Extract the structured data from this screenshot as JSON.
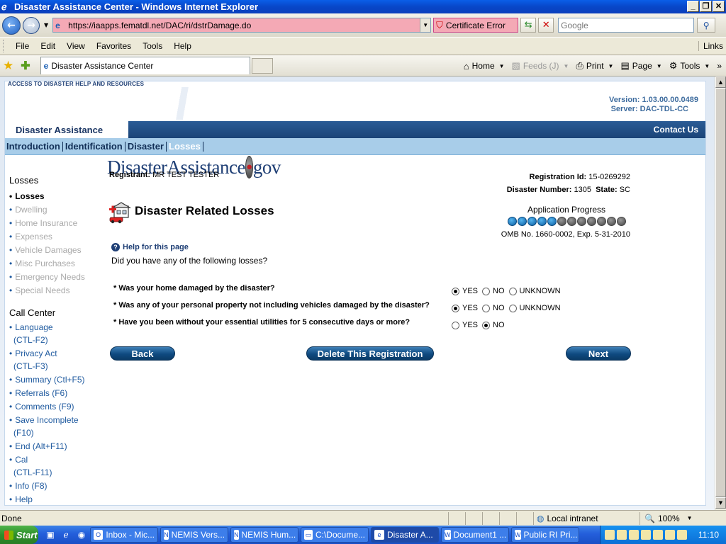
{
  "window": {
    "title": "Disaster Assistance Center - Windows Internet Explorer",
    "minimize": "_",
    "restore": "❐",
    "close": "✕"
  },
  "address": {
    "url": "https://iaapps.fematdl.net/DAC/ri/dstrDamage.do",
    "cert_error": "Certificate Error",
    "search_placeholder": "Google"
  },
  "menu": {
    "items": [
      "File",
      "Edit",
      "View",
      "Favorites",
      "Tools",
      "Help"
    ],
    "links": "Links"
  },
  "tabbar": {
    "tab_label": "Disaster Assistance Center",
    "home": "Home",
    "feeds": "Feeds (J)",
    "print": "Print",
    "page": "Page",
    "tools": "Tools"
  },
  "header": {
    "logo_main": "DisasterAssistance",
    "logo_dot": "•",
    "logo_gov": "gov",
    "logo_tag": "ACCESS TO DISASTER HELP AND RESOURCES",
    "version": "Version: 1.03.00.00.0489",
    "server": "Server: DAC-TDL-CC",
    "brand": "Disaster Assistance",
    "contact": "Contact Us"
  },
  "nav": {
    "tabs": [
      "Introduction",
      "Identification",
      "Disaster",
      "Losses"
    ],
    "active_index": 3
  },
  "sidebar": {
    "losses_head": "Losses",
    "losses_items": [
      "Losses",
      "Dwelling",
      "Home Insurance",
      "Expenses",
      "Vehicle Damages",
      "Misc Purchases",
      "Emergency Needs",
      "Special Needs"
    ],
    "call_head": "Call Center",
    "call_items": {
      "language": "Language",
      "language_key": "(CTL-F2)",
      "privacy": "Privacy Act",
      "privacy_key": "(CTL-F3)",
      "summary": "Summary (Ctl+F5)",
      "referrals": "Referrals (F6)",
      "comments": "Comments (F9)",
      "save": "Save Incomplete",
      "save_key": "(F10)",
      "end": "End (Alt+F11)",
      "cal": "Cal",
      "cal_key": "(CTL-F11)",
      "info": "Info (F8)",
      "help": "Help"
    }
  },
  "main": {
    "registrant_label": "Registrant:",
    "registrant_value": "MR TEST TESTER",
    "regid_label": "Registration Id:",
    "regid_value": "15-0269292",
    "disaster_label": "Disaster Number:",
    "disaster_value": "1305",
    "state_label": "State:",
    "state_value": "SC",
    "title": "Disaster Related Losses",
    "progress_label": "Application Progress",
    "progress_steps": 12,
    "progress_done": 5,
    "omb": "OMB No. 1660-0002, Exp. 5-31-2010",
    "help_link": "Help for this page",
    "question": "Did you have any of the following losses?",
    "q1": "* Was your home damaged by the disaster?",
    "q2": "* Was any of your personal property not including vehicles damaged by the disaster?",
    "q3": "* Have you been without your essential utilities for 5 consecutive days or more?",
    "opt_yes": "YES",
    "opt_no": "NO",
    "opt_unknown": "UNKNOWN",
    "back": "Back",
    "delete": "Delete This Registration",
    "next": "Next"
  },
  "status": {
    "done": "Done",
    "zone": "Local intranet",
    "zoom": "100%"
  },
  "taskbar": {
    "start": "Start",
    "tasks": [
      "Inbox - Mic...",
      "NEMIS Vers...",
      "NEMIS Hum...",
      "C:\\Docume...",
      "Disaster A...",
      "Document1 ...",
      "Public RI Pri..."
    ],
    "active_index": 4,
    "time": "11:10"
  }
}
